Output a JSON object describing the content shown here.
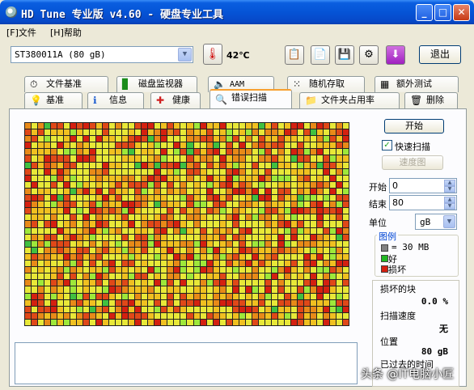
{
  "window": {
    "title": "HD Tune 专业版 v4.60 - 硬盘专业工具"
  },
  "menu": {
    "file": "[F]文件",
    "help": "[H]帮助"
  },
  "toolbar": {
    "drive": "ST380011A (80 gB)",
    "temperature": "42℃",
    "exit_label": "退出"
  },
  "tabs_top": [
    "文件基准",
    "磁盘监视器",
    "AAM",
    "随机存取",
    "额外测试"
  ],
  "tabs_bottom": [
    "基准",
    "信息",
    "健康",
    "错误扫描",
    "文件夹占用率",
    "删除"
  ],
  "active_tab": "错误扫描",
  "controls": {
    "start_label": "开始",
    "quick_scan_label": "快速扫描",
    "quick_scan_checked": true,
    "speed_map_label": "速度图",
    "start_field_label": "开始",
    "start_value": "0",
    "end_field_label": "结束",
    "end_value": "80",
    "unit_label": "单位",
    "unit_value": "gB"
  },
  "legend": {
    "title": "图例",
    "block_size": "= 30 MB",
    "good": "好",
    "bad": "损坏",
    "colors": {
      "block": "#808080",
      "good": "#22b822",
      "bad": "#d42010"
    }
  },
  "stats": {
    "damaged_blocks_label": "损坏的块",
    "damaged_blocks_value": "0.0 %",
    "scan_speed_label": "扫描速度",
    "scan_speed_value": "无",
    "position_label": "位置",
    "position_value": "80 gB",
    "elapsed_label": "已过去的时间"
  },
  "watermark": "头条 @IT电脑小匠",
  "scan_grid": {
    "columns": 50,
    "rows": 31,
    "palette": [
      "#e8e838",
      "#f0c020",
      "#e88a18",
      "#e04818",
      "#d42010",
      "#9ee83a",
      "#40c040"
    ]
  }
}
